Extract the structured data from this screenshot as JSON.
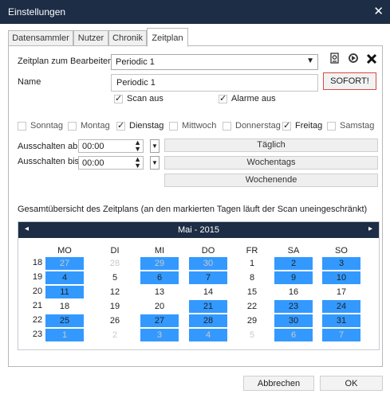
{
  "window": {
    "title": "Einstellungen",
    "close_glyph": "✕"
  },
  "tabs": [
    {
      "label": "Datensammler",
      "active": false
    },
    {
      "label": "Nutzer",
      "active": false
    },
    {
      "label": "Chronik",
      "active": false
    },
    {
      "label": "Zeitplan",
      "active": true
    }
  ],
  "schedule": {
    "edit_label": "Zeitplan zum Bearbeiten:",
    "selected": "Periodic 1",
    "icons": [
      "edit-icon",
      "refresh-icon",
      "delete-icon"
    ],
    "name_label": "Name",
    "name_value": "Periodic 1",
    "sofort_label": "SOFORT!",
    "scan_off": {
      "label": "Scan aus",
      "checked": true
    },
    "alarms_off": {
      "label": "Alarme aus",
      "checked": true
    }
  },
  "days": [
    {
      "label": "Sonntag",
      "checked": false
    },
    {
      "label": "Montag",
      "checked": false
    },
    {
      "label": "Dienstag",
      "checked": true
    },
    {
      "label": "Mittwoch",
      "checked": false
    },
    {
      "label": "Donnerstag",
      "checked": false
    },
    {
      "label": "Freitag",
      "checked": true
    },
    {
      "label": "Samstag",
      "checked": false
    }
  ],
  "off_from": {
    "label": "Ausschalten ab",
    "value": "00:00"
  },
  "off_until": {
    "label": "Ausschalten bis",
    "value": "00:00"
  },
  "quick_buttons": [
    "Täglich",
    "Wochentags",
    "Wochenende"
  ],
  "overview_label": "Gesamtübersicht des Zeitplans (an den markierten Tagen läuft der Scan uneingeschränkt)",
  "calendar": {
    "month": "Mai - 2015",
    "weekdays": [
      "MO",
      "DI",
      "MI",
      "DO",
      "FR",
      "SA",
      "SO"
    ],
    "weeks": [
      "18",
      "19",
      "20",
      "21",
      "22",
      "23"
    ],
    "rows": [
      [
        {
          "d": "27",
          "hl": true,
          "dim": true
        },
        {
          "d": "28",
          "hl": false,
          "dim": true
        },
        {
          "d": "29",
          "hl": true,
          "dim": true
        },
        {
          "d": "30",
          "hl": true,
          "dim": true
        },
        {
          "d": "1",
          "hl": false,
          "dim": false
        },
        {
          "d": "2",
          "hl": true,
          "dim": false
        },
        {
          "d": "3",
          "hl": true,
          "dim": false
        }
      ],
      [
        {
          "d": "4",
          "hl": true,
          "dim": false
        },
        {
          "d": "5",
          "hl": false,
          "dim": false
        },
        {
          "d": "6",
          "hl": true,
          "dim": false
        },
        {
          "d": "7",
          "hl": true,
          "dim": false
        },
        {
          "d": "8",
          "hl": false,
          "dim": false
        },
        {
          "d": "9",
          "hl": true,
          "dim": false
        },
        {
          "d": "10",
          "hl": true,
          "dim": false
        }
      ],
      [
        {
          "d": "11",
          "hl": true,
          "dim": false
        },
        {
          "d": "12",
          "hl": false,
          "dim": false
        },
        {
          "d": "13",
          "hl": false,
          "dim": false
        },
        {
          "d": "14",
          "hl": false,
          "dim": false
        },
        {
          "d": "15",
          "hl": false,
          "dim": false
        },
        {
          "d": "16",
          "hl": false,
          "dim": false
        },
        {
          "d": "17",
          "hl": false,
          "dim": false
        }
      ],
      [
        {
          "d": "18",
          "hl": false,
          "dim": false
        },
        {
          "d": "19",
          "hl": false,
          "dim": false
        },
        {
          "d": "20",
          "hl": false,
          "dim": false
        },
        {
          "d": "21",
          "hl": true,
          "dim": false
        },
        {
          "d": "22",
          "hl": false,
          "dim": false
        },
        {
          "d": "23",
          "hl": true,
          "dim": false
        },
        {
          "d": "24",
          "hl": true,
          "dim": false
        }
      ],
      [
        {
          "d": "25",
          "hl": true,
          "dim": false
        },
        {
          "d": "26",
          "hl": false,
          "dim": false
        },
        {
          "d": "27",
          "hl": true,
          "dim": false
        },
        {
          "d": "28",
          "hl": true,
          "dim": false
        },
        {
          "d": "29",
          "hl": false,
          "dim": false
        },
        {
          "d": "30",
          "hl": true,
          "dim": false
        },
        {
          "d": "31",
          "hl": true,
          "dim": false
        }
      ],
      [
        {
          "d": "1",
          "hl": true,
          "dim": true
        },
        {
          "d": "2",
          "hl": false,
          "dim": true
        },
        {
          "d": "3",
          "hl": true,
          "dim": true
        },
        {
          "d": "4",
          "hl": true,
          "dim": true
        },
        {
          "d": "5",
          "hl": false,
          "dim": true
        },
        {
          "d": "6",
          "hl": true,
          "dim": true
        },
        {
          "d": "7",
          "hl": true,
          "dim": true
        }
      ]
    ]
  },
  "footer": {
    "cancel": "Abbrechen",
    "ok": "OK"
  },
  "colors": {
    "titlebar": "#1d2d45",
    "highlight": "#3399ff",
    "sofort_border": "#d94b3f"
  }
}
